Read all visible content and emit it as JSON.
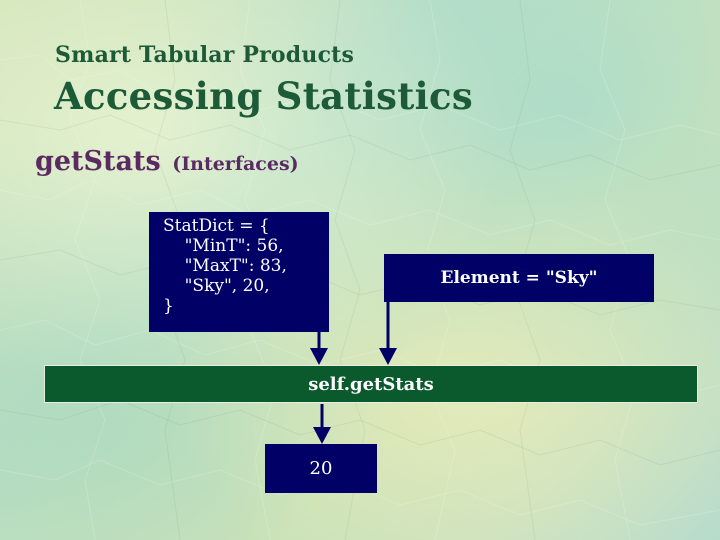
{
  "slide": {
    "subtitle": "Smart Tabular Products",
    "title": "Accessing Statistics"
  },
  "method": {
    "name": "getStats",
    "note": "(Interfaces)"
  },
  "diagram": {
    "stat_dict": {
      "lines": [
        "StatDict = {",
        "    \"MinT\": 56,",
        "    \"MaxT\": 83,",
        "    \"Sky\", 20,",
        "}"
      ]
    },
    "element_param": "Element = \"Sky\"",
    "method_call": "self.getStats",
    "result": "20"
  },
  "colors": {
    "title_green": "#1d5a37",
    "heading_purple": "#5b2a63",
    "box_navy": "#000066",
    "bar_green": "#0b5a2e"
  }
}
